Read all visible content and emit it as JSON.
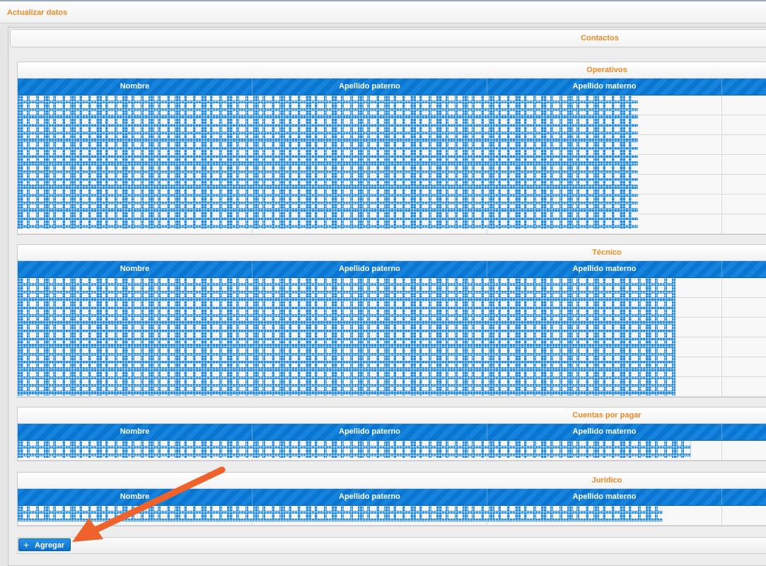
{
  "header": {
    "title": "Actualizar datos"
  },
  "contacts": {
    "title": "Contactos"
  },
  "columns": [
    "Nombre",
    "Apellido paterno",
    "Apellido materno"
  ],
  "sections": [
    {
      "title": "Operativos",
      "rows": 7
    },
    {
      "title": "Técnico",
      "rows": 6
    },
    {
      "title": "Cuentas por pagar",
      "rows": 1
    },
    {
      "title": "Jurídico",
      "rows": 1
    }
  ],
  "add_button": {
    "label": "Agregar",
    "icon": "plus-icon"
  },
  "colors": {
    "accent": "#e98b25",
    "header_blue": "#0a76d2",
    "arrow": "#f0622c"
  }
}
